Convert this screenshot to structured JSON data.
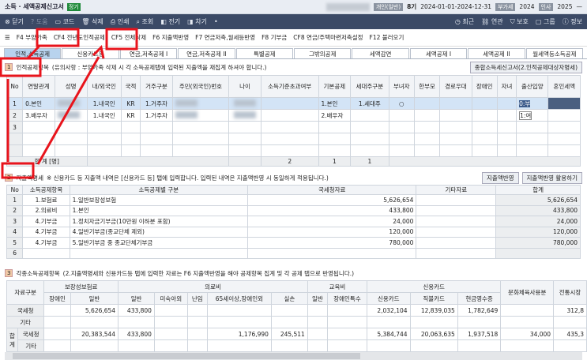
{
  "title": {
    "app": "소득 · 세액공제신고서",
    "badge": "정기",
    "corp_type": "개인(일반)",
    "term": "8기",
    "period": "2024-01-01-2024-12-31",
    "label_fiscal": "부가세",
    "fiscal_year": "2024",
    "label_hr": "인사",
    "hr_year": "2025"
  },
  "toolbar": {
    "left": [
      "닫기",
      "도움",
      "코드",
      "삭제",
      "인쇄",
      "조회",
      "전기",
      "차기"
    ],
    "right": [
      "최근",
      "연관",
      "보호",
      "그룹",
      "정보"
    ]
  },
  "fkeys": [
    "F4 부양가족",
    "CF4 전년도인적공제",
    "CF5 전체삭제",
    "F6 지출액반영",
    "F7 연금저축,월세등반영",
    "F8 기부금",
    "CF8 연금/주택마련저축설정",
    "F12 불러오기"
  ],
  "tabs": [
    "인적,소득공제",
    "신용카드등",
    "연금,저축공제 I",
    "연금,저축공제 II",
    "특별공제",
    "그밖의공제",
    "세액감면",
    "세액공제 I",
    "세액공제 II",
    "월세액등소득공제"
  ],
  "sec1": {
    "num": "1",
    "title": "인적공제항목",
    "note": "(유의사항 : 부양가족 삭제 시 각 소득공제탭에 입력된 지출액을 재집계 하셔야 합니다.)",
    "button": "종합소득세신고서(2.인적공제대상자명세)",
    "headers": [
      "No",
      "연말관계",
      "성명",
      "내/외국인",
      "국적",
      "거주구분",
      "주민(외국인)번호",
      "나이",
      "소득기준초과여부",
      "기본공제",
      "세대주구분",
      "부녀자",
      "한부모",
      "경로우대",
      "장애인",
      "자녀",
      "출산입양",
      "혼인세액"
    ],
    "rows": [
      [
        "1",
        "0.본인",
        "",
        "1.내국인",
        "KR",
        "1.거주자",
        "",
        "",
        "",
        "1.본인",
        "1.세대주",
        "○"
      ],
      [
        "2",
        "3.배우자",
        "",
        "1.내국인",
        "KR",
        "1.거주자",
        "",
        "",
        "",
        "2.배우자",
        "",
        ""
      ],
      [
        "3",
        "",
        "",
        "",
        "",
        "",
        "",
        "",
        "",
        "",
        "",
        ""
      ]
    ],
    "dropdown": [
      "0:부",
      "1:여"
    ],
    "total": {
      "label": "합 계 [명]",
      "basic": "2",
      "head": "1",
      "female": "1"
    }
  },
  "sec2": {
    "num": "2",
    "title": "지출액명세",
    "note": "※ 신용카드 등 지출액 내역은 [신용카드 등] 탭에 입력합니다. 입력된 내역은 지출액반영 시 동일하게 적용됩니다.)",
    "buttons": [
      "지출액반영",
      "지출액반영 활용하기"
    ],
    "headers": [
      "No",
      "소득공제항목",
      "소득공제별 구분",
      "국세청자료",
      "기타자료",
      "합계"
    ],
    "rows": [
      [
        "1",
        "1.보험료",
        "1.일반보장성보험",
        "5,626,654",
        "",
        "5,626,654"
      ],
      [
        "2",
        "2.의료비",
        "1.본인",
        "433,800",
        "",
        "433,800"
      ],
      [
        "3",
        "4.기부금",
        "1.정치자금기부금(10만원 이하분 포함)",
        "24,000",
        "",
        "24,000"
      ],
      [
        "4",
        "4.기부금",
        "4.일반기부금(종교단체 제외)",
        "120,000",
        "",
        "120,000"
      ],
      [
        "5",
        "4.기부금",
        "5.일반기부금 중 종교단체기부금",
        "780,000",
        "",
        "780,000"
      ],
      [
        "6",
        "",
        "",
        "",
        "",
        ""
      ]
    ]
  },
  "sec3": {
    "num": "3",
    "title": "각종소득공제항목",
    "note": "(2.지출액명세와 신용카드등 탭에 입력한 자료는 F6 지출액반영을 해야 공제항목 집계 및 각 공제 탭으로 반영됩니다.)",
    "groups": [
      "자료구분",
      "보장성보험료",
      "의료비",
      "교육비",
      "신용카드",
      "문화체육사용분",
      "전통시장"
    ],
    "subheaders": [
      "장애인",
      "일반",
      "일반",
      "미숙아외",
      "난임",
      "65세이상,장애인외",
      "실손",
      "일반",
      "장애인특수",
      "신용카드",
      "직불카드",
      "현금영수증"
    ],
    "sum_label": "합계",
    "rows": [
      [
        "국세청",
        "",
        "5,626,654",
        "433,800",
        "",
        "",
        "",
        "",
        "",
        "",
        "2,032,104",
        "12,839,035",
        "1,782,649",
        "",
        "312,8"
      ],
      [
        "기타",
        "",
        "",
        "",
        "",
        "",
        "",
        "",
        "",
        "",
        "",
        "",
        "",
        "",
        ""
      ],
      [
        "국세청",
        "",
        "20,383,544",
        "433,800",
        "",
        "",
        "1,176,990",
        "245,511",
        "",
        "",
        "5,384,744",
        "20,063,635",
        "1,937,518",
        "34,000",
        "435,3"
      ],
      [
        "기타",
        "",
        "",
        "",
        "",
        "",
        "",
        "",
        "",
        "",
        "",
        "",
        "",
        "",
        ""
      ]
    ]
  },
  "colors": {
    "toolbar": "#3b4a66",
    "highlight": "#e8141c",
    "tab_active": "#b8d3ee"
  }
}
